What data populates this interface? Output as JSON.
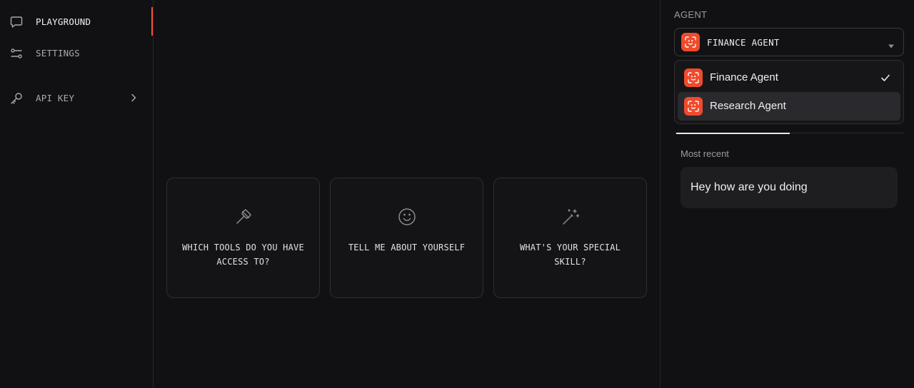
{
  "sidebar": {
    "items": [
      {
        "label": "PLAYGROUND",
        "icon": "chat-bubble-icon",
        "active": true
      },
      {
        "label": "SETTINGS",
        "icon": "sliders-icon",
        "active": false
      },
      {
        "label": "API KEY",
        "icon": "key-icon",
        "active": false
      }
    ]
  },
  "suggestions": [
    {
      "text": "WHICH TOOLS DO YOU HAVE ACCESS TO?",
      "icon": "hammer-icon"
    },
    {
      "text": "TELL ME ABOUT YOURSELF",
      "icon": "smiley-icon"
    },
    {
      "text": "WHAT'S YOUR SPECIAL SKILL?",
      "icon": "magic-wand-icon"
    }
  ],
  "agent_panel": {
    "label": "AGENT",
    "selected": "FINANCE AGENT",
    "options": [
      {
        "label": "Finance Agent",
        "checked": true
      },
      {
        "label": "Research Agent",
        "checked": false
      }
    ]
  },
  "history": {
    "section_label": "Most recent",
    "items": [
      "Hey how are you doing"
    ]
  },
  "colors": {
    "background": "#111113",
    "accent": "#f04a2c",
    "active_indicator": "#ff4e2f"
  }
}
